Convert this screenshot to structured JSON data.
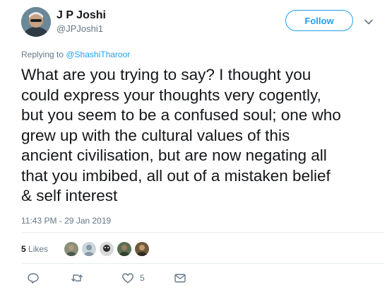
{
  "user": {
    "display_name": "J P Joshi",
    "handle": "@JPJoshi1"
  },
  "follow_button": {
    "label": "Follow"
  },
  "reply_context": {
    "prefix": "Replying to ",
    "mention": "@ShashiTharoor"
  },
  "tweet": {
    "text": "What are you trying to say? I thought you\ncould express your thoughts very cogently,\nbut you seem to be a confused soul; one who\ngrew up with the cultural values of this\nancient civilisation,  but are now negating all\nthat you imbibed, all out of a mistaken belief\n& self interest",
    "timestamp": "11:43 PM - 29 Jan 2019"
  },
  "likes": {
    "count": "5",
    "label": "Likes"
  },
  "actions": {
    "reply_icon": "reply-icon",
    "retweet_icon": "retweet-icon",
    "like_icon": "heart-icon",
    "like_count": "5",
    "dm_icon": "envelope-icon"
  },
  "colors": {
    "accent": "#1da1f2",
    "secondary_text": "#657786",
    "primary_text": "#14171a",
    "divider": "#e6ecf0"
  }
}
